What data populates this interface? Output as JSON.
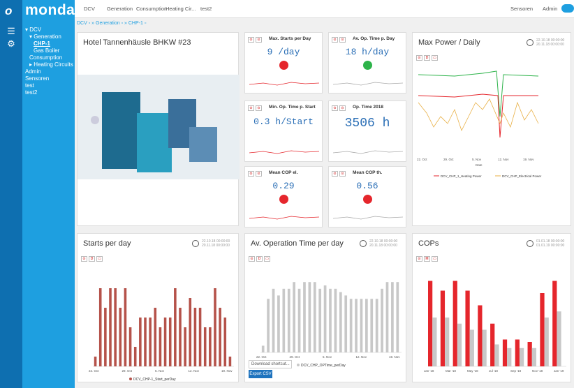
{
  "app": {
    "logo": "mondas"
  },
  "topnav": {
    "items": [
      "DCV",
      "Generation",
      "Consumption",
      "Heating Cir...",
      "test2"
    ],
    "right": [
      "Sensoren",
      "Admin"
    ]
  },
  "breadcrumb": {
    "items": [
      "DCV",
      "Generation",
      "CHP-1"
    ]
  },
  "tree": {
    "items": [
      {
        "label": "DCV",
        "indent": 0,
        "arrow": "down"
      },
      {
        "label": "Generation",
        "indent": 1,
        "arrow": "down"
      },
      {
        "label": "CHP-1",
        "indent": 2,
        "active": true
      },
      {
        "label": "Gas Boiler",
        "indent": 2
      },
      {
        "label": "Consumption",
        "indent": 1
      },
      {
        "label": "Heating Circuits",
        "indent": 1,
        "arrow": "right"
      },
      {
        "label": "Admin",
        "indent": 0
      },
      {
        "label": "Sensoren",
        "indent": 0
      },
      {
        "label": "test",
        "indent": 0
      },
      {
        "label": "test2",
        "indent": 0
      }
    ]
  },
  "main": {
    "title": "Hotel Tannenhäusle BHKW #23"
  },
  "tiles": [
    {
      "title": "Max. Starts per Day",
      "value": "9 /day",
      "status": "red"
    },
    {
      "title": "Av. Op. Time p. Day",
      "value": "18 h/day",
      "status": "green"
    },
    {
      "title": "Min. Op. Time p. Start",
      "value": "0.3 h/Start",
      "status": ""
    },
    {
      "title": "Op. Time 2018",
      "value": "3506 h",
      "status": ""
    },
    {
      "title": "Mean COP el.",
      "value": "0.29",
      "status": "red"
    },
    {
      "title": "Mean COP th.",
      "value": "0.56",
      "status": "red"
    }
  ],
  "colors": {
    "accent": "#1e9fe0",
    "red": "#e5262c",
    "green": "#2db34a",
    "bar_red": "#b5524a",
    "bar_grey": "#c8c8c8"
  },
  "maxpower": {
    "title": "Max Power / Daily",
    "dates": [
      "22.10.18 00:00:00",
      "20.11.18 00:00:00"
    ],
    "ticks": [
      "22. Oct",
      "29. Oct",
      "5. Nov",
      "12. Nov",
      "19. Nov"
    ],
    "xlabel": "Date",
    "legend": [
      "DCV_CHP_1_Heating Power",
      "DCV_CHP_Electrical Power"
    ]
  },
  "starts": {
    "title": "Starts per day",
    "dates": [
      "22.10.18 00:00:00",
      "20.11.18 00:00:00"
    ],
    "ticks": [
      "22. Oct",
      "29. Oct",
      "5. Nov",
      "12. Nov",
      "19. Nov"
    ],
    "legend": "DCV_CHP-1_Start_perDay"
  },
  "optime": {
    "title": "Av. Operation Time per day",
    "dates": [
      "22.10.18 00:00:00",
      "20.11.18 00:00:00"
    ],
    "ticks": [
      "22. Oct",
      "29. Oct",
      "5. Nov",
      "12. Nov",
      "19. Nov"
    ],
    "legend": "DCV_CHP_OPTime_perDay",
    "download": "Download shortcut...",
    "export": "Export CSV"
  },
  "cops": {
    "title": "COPs",
    "dates": [
      "01.01.18 00:00:00",
      "01.01.19 00:00:00"
    ],
    "ticks": [
      "Jan '18",
      "Mar '18",
      "May '18",
      "Jul '18",
      "Sep '18",
      "Nov '18",
      "Jan '19"
    ]
  },
  "chart_data": [
    {
      "type": "bar",
      "title": "Starts per day",
      "values": [
        1,
        8,
        6,
        8,
        8,
        6,
        8,
        4,
        2,
        5,
        5,
        5,
        6,
        4,
        5,
        5,
        8,
        6,
        4,
        7,
        6,
        6,
        4,
        4,
        8,
        6,
        5,
        1
      ],
      "ylim": [
        0,
        10
      ]
    },
    {
      "type": "bar",
      "title": "Av. Operation Time per day",
      "values": [
        2,
        16,
        19,
        17,
        19,
        19,
        21,
        19,
        21,
        21,
        21,
        19,
        20,
        19,
        19,
        18,
        17,
        16,
        16,
        16,
        16,
        16,
        16,
        19,
        21,
        21,
        21
      ],
      "ylim": [
        0,
        25
      ]
    },
    {
      "type": "bar",
      "title": "COPs",
      "series": [
        {
          "name": "el",
          "values": [
            0.7,
            0.62,
            0.7,
            0.62,
            0.5,
            0.35,
            0.22,
            0.22,
            0.2,
            0.6,
            0.7
          ]
        },
        {
          "name": "th",
          "values": [
            0.4,
            0.4,
            0.35,
            0.3,
            0.3,
            0.18,
            0.15,
            0.15,
            0.15,
            0.4,
            0.45
          ]
        }
      ],
      "ylim": [
        0,
        0.8
      ]
    }
  ]
}
